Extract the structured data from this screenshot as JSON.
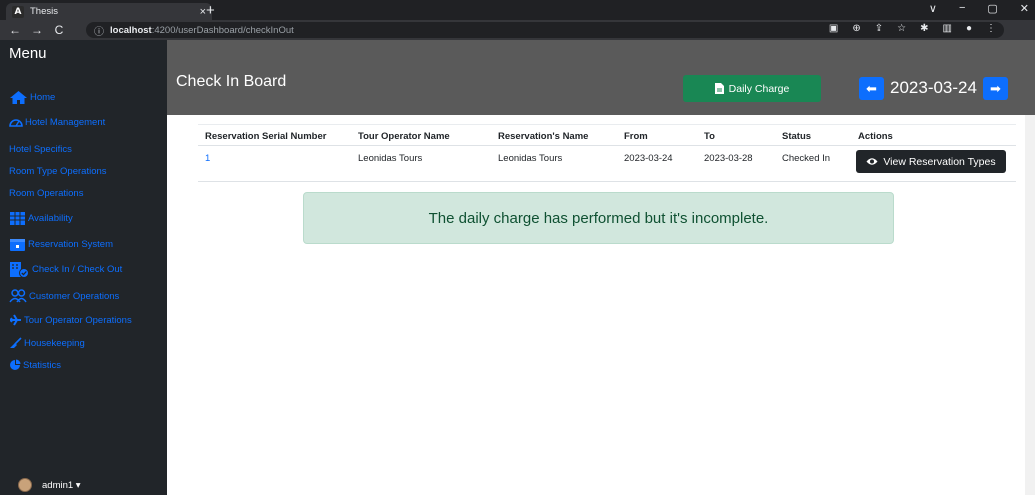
{
  "browser": {
    "tab_favicon": "A",
    "tab_title": "Thesis",
    "tab_close": "×",
    "new_tab": "+",
    "url_host": "localhost",
    "url_path": ":4200/userDashboard/checkInOut",
    "window_controls": [
      "∨",
      "−",
      "▢",
      "✕"
    ]
  },
  "sidebar": {
    "title": "Menu",
    "items": [
      {
        "label": "Home",
        "icon": "home-icon"
      },
      {
        "label": "Hotel Management",
        "icon": "gauge-icon"
      },
      {
        "label": "Hotel Specifics",
        "icon": ""
      },
      {
        "label": "Room Type Operations",
        "icon": ""
      },
      {
        "label": "Room Operations",
        "icon": ""
      },
      {
        "label": "Availability",
        "icon": "table-icon"
      },
      {
        "label": "Reservation System",
        "icon": "calendar-icon"
      },
      {
        "label": "Check In / Check Out",
        "icon": "building-check-icon"
      },
      {
        "label": "Customer Operations",
        "icon": "users-icon"
      },
      {
        "label": "Tour Operator Operations",
        "icon": "plane-icon"
      },
      {
        "label": "Housekeeping",
        "icon": "broom-icon"
      },
      {
        "label": "Statistics",
        "icon": "pie-chart-icon"
      }
    ],
    "user": "admin1 ▾"
  },
  "header": {
    "title": "Check In Board",
    "daily_charge": "Daily Charge",
    "date": "2023-03-24"
  },
  "table": {
    "columns": [
      "Reservation Serial Number",
      "Tour Operator Name",
      "Reservation's Name",
      "From",
      "To",
      "Status",
      "Actions"
    ],
    "rows": [
      {
        "serial": "1",
        "tour_operator": "Leonidas Tours",
        "reservation_name": "Leonidas Tours",
        "from": "2023-03-24",
        "to": "2023-03-28",
        "status": "Checked In",
        "action": "View Reservation Types"
      }
    ]
  },
  "alert": {
    "message": "The daily charge has performed but it's incomplete."
  },
  "colors": {
    "sidebar_bg": "#212529",
    "header_bg": "#5a5a5a",
    "link_blue": "#0d6efd",
    "success_green": "#198754",
    "alert_bg": "#d1e7dd",
    "alert_text": "#0f5132"
  }
}
